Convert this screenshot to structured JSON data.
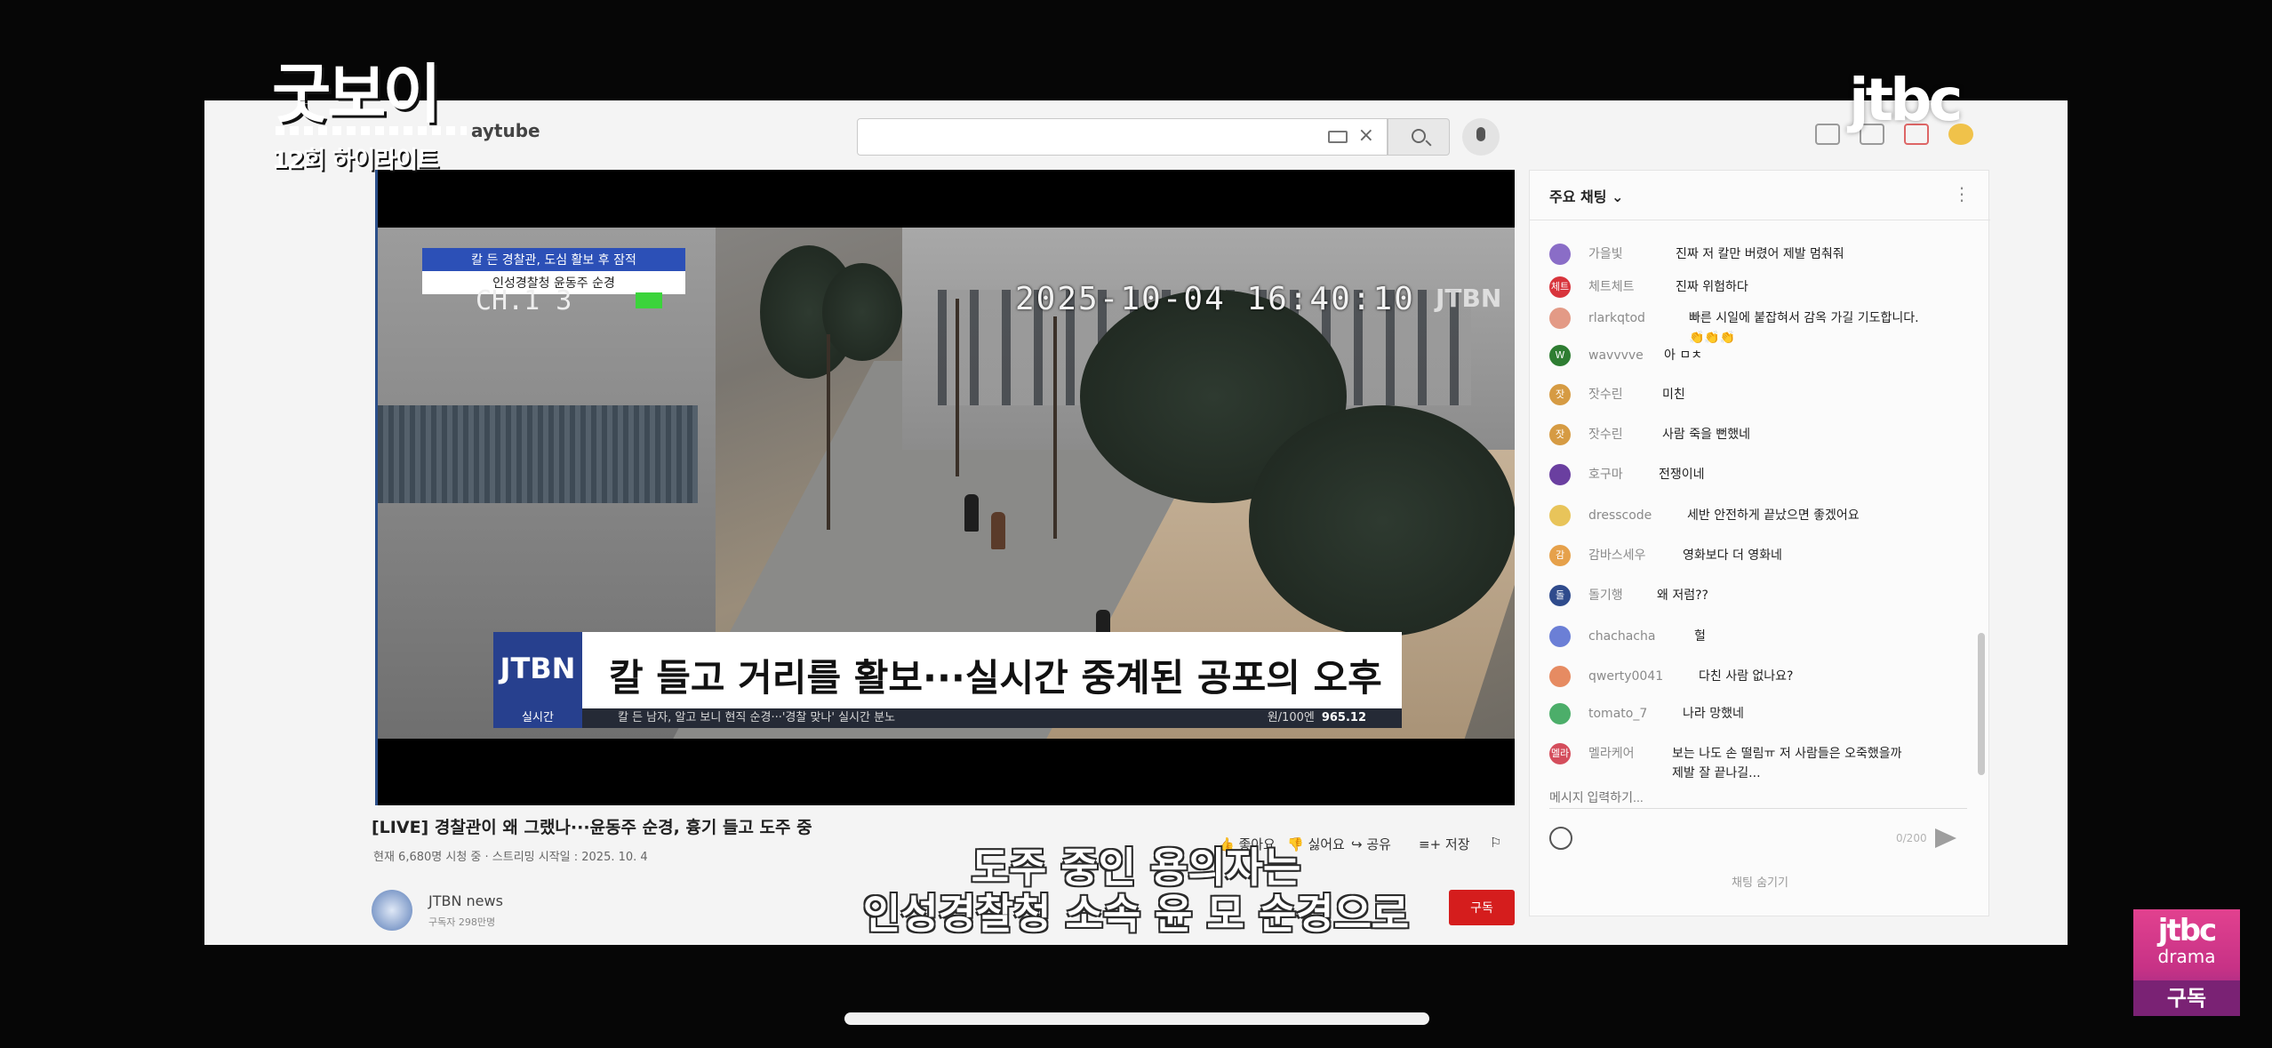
{
  "program": {
    "title": "굿보이",
    "episode_label": "12회 하이라이트",
    "network": "jtbc"
  },
  "browser": {
    "logo_text": "aytube",
    "search": {
      "value": "",
      "placeholder": ""
    }
  },
  "video": {
    "osd": {
      "timestamp": "2025-10-04  16:40:10",
      "watermark": "JTBN",
      "channel": "CH.1 3"
    },
    "news_box": {
      "line1": "칼 든 경찰관, 도심 활보 후 잠적",
      "line2": "인성경찰청 윤동주 순경"
    },
    "lower_third": {
      "logo": "JTBN",
      "headline": "칼 들고 거리를 활보···실시간 중계된 공포의 오후",
      "live_tag": "실시간",
      "ticker": "칼 든 남자, 알고 보니 현직 순경···'경찰 맞나' 실시간 분노",
      "index_label": "원/100엔",
      "index_value": "965.12"
    },
    "title": "[LIVE] 경찰관이 왜 그랬나···윤동주 순경, 흉기 들고 도주 중",
    "meta": "현재 6,680명 시청 중 · 스트리밍 시작일 : 2025. 10. 4",
    "actions": {
      "like": "좋아요",
      "dislike": "싫어요",
      "share": "공유",
      "save": "저장"
    },
    "channel": {
      "name": "JTBN news",
      "subs": "구독자 298만명",
      "subscribe_label": "구독"
    }
  },
  "chat": {
    "header": "주요 채팅",
    "messages": [
      {
        "author": "가을빛",
        "text": "진짜 저 칼만 버렸어 제발 멈춰줘",
        "avatar_color": "#8a6dc7",
        "avatar_text": ""
      },
      {
        "author": "체트체트",
        "text": "진짜 위험하다",
        "avatar_color": "#d8343c",
        "avatar_text": "체트"
      },
      {
        "author": "rlarkqtod",
        "text": "빠른 시일에 붙잡혀서 감옥 가길 기도합니다.",
        "text2": "👏👏👏",
        "avatar_color": "#e39a86",
        "avatar_text": ""
      },
      {
        "author": "wavvvve",
        "text": "아 ㅁㅊ",
        "avatar_color": "#2e7d32",
        "avatar_text": "W"
      },
      {
        "author": "잣수린",
        "text": "미친",
        "avatar_color": "#d69b43",
        "avatar_text": "잣"
      },
      {
        "author": "잣수린",
        "text": "사람 죽을 뻔했네",
        "avatar_color": "#d69b43",
        "avatar_text": "잣"
      },
      {
        "author": "호구마",
        "text": "전쟁이네",
        "avatar_color": "#6a3fa0",
        "avatar_text": ""
      },
      {
        "author": "dresscode",
        "text": "세반 안전하게 끝났으면 좋겠어요",
        "avatar_color": "#e8c45a",
        "avatar_text": ""
      },
      {
        "author": "감바스세우",
        "text": "영화보다 더 영화네",
        "avatar_color": "#e6a14b",
        "avatar_text": "감"
      },
      {
        "author": "돌기행",
        "text": "왜 저럼??",
        "avatar_color": "#2f4b8c",
        "avatar_text": "돌"
      },
      {
        "author": "chachacha",
        "text": "헐",
        "avatar_color": "#6b7fd6",
        "avatar_text": ""
      },
      {
        "author": "qwerty0041",
        "text": "다친 사람 없나요?",
        "avatar_color": "#e68b62",
        "avatar_text": ""
      },
      {
        "author": "tomato_7",
        "text": "나라 망했네",
        "avatar_color": "#4cae6a",
        "avatar_text": ""
      },
      {
        "author": "멜라케어",
        "text": "보는 나도 손 떨림ㅠ 저 사람들은 오죽했을까",
        "text2": "제발 잘 끝나길...",
        "avatar_color": "#d44d5c",
        "avatar_text": "멜라"
      }
    ],
    "input_placeholder": "메시지 입력하기...",
    "counter": "0/200",
    "footer": "채팅 숨기기"
  },
  "subtitles": {
    "line1": "도주 중인 용의자는",
    "line2": "인성경찰청 소속 윤 모 순경으로"
  },
  "drama_badge": {
    "logo": "jtbc",
    "word": "drama",
    "subscribe": "구독"
  },
  "colors": {
    "subscribe_red": "#d51d1d",
    "news_blue": "#27408e",
    "drama_pink": "#d13a8a"
  }
}
